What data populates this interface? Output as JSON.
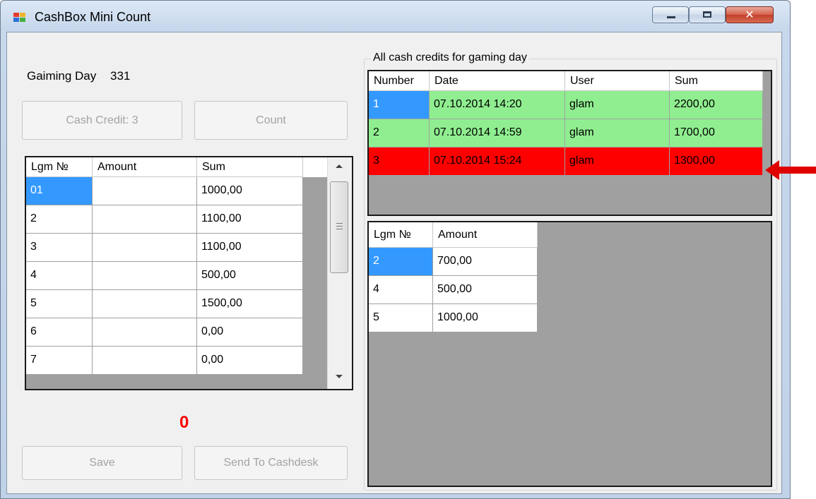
{
  "window": {
    "title": "CashBox Mini Count",
    "close_glyph": "✕"
  },
  "gaming_day": {
    "label": "Gaiming Day",
    "value": "331"
  },
  "buttons": {
    "cash_credit": "Cash Credit:  3",
    "count": "Count",
    "save": "Save",
    "send_to_cashdesk": "Send To Cashdesk"
  },
  "left_grid": {
    "columns": [
      "Lgm №",
      "Amount",
      "Sum"
    ],
    "rows": [
      [
        "01",
        "",
        "1000,00"
      ],
      [
        "2",
        "",
        "1100,00"
      ],
      [
        "3",
        "",
        "1100,00"
      ],
      [
        "4",
        "",
        "500,00"
      ],
      [
        "5",
        "",
        "1500,00"
      ],
      [
        "6",
        "",
        "0,00"
      ],
      [
        "7",
        "",
        "0,00"
      ]
    ],
    "selected_row": 0
  },
  "total": "0",
  "credits_group": {
    "caption": "All cash credits for gaming day",
    "columns": [
      "Number",
      "Date",
      "User",
      "Sum"
    ],
    "rows": [
      [
        "1",
        "07.10.2014 14:20",
        "glam",
        "2200,00"
      ],
      [
        "2",
        "07.10.2014 14:59",
        "glam",
        "1700,00"
      ],
      [
        "3",
        "07.10.2014 15:24",
        "glam",
        "1300,00"
      ]
    ],
    "row_colors": [
      "#90ee90",
      "#90ee90",
      "#ff0000"
    ]
  },
  "detail_grid": {
    "columns": [
      "Lgm №",
      "Amount"
    ],
    "rows": [
      [
        "2",
        "700,00"
      ],
      [
        "4",
        "500,00"
      ],
      [
        "5",
        "1000,00"
      ]
    ],
    "selected_row": 0
  },
  "colors": {
    "selection": "#3399ff",
    "highlight_green": "#90ee90",
    "highlight_red": "#ff0000",
    "grid_background": "#a0a0a0",
    "annotation_arrow": "#e00000"
  },
  "icons": [
    "app-icon",
    "minimize-icon",
    "maximize-icon",
    "close-icon",
    "scroll-up-icon",
    "scroll-down-icon",
    "annotation-arrow-icon"
  ]
}
